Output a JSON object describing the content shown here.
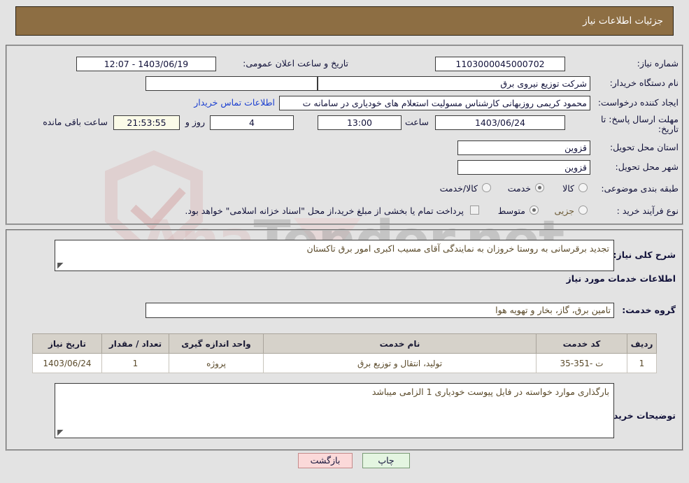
{
  "header": {
    "title": "جزئیات اطلاعات نیاز"
  },
  "form": {
    "need_number": {
      "label": "شماره نیاز:",
      "value": "1103000045000702"
    },
    "public_announce": {
      "label": "تاریخ و ساعت اعلان عمومی:",
      "value": "1403/06/19 - 12:07"
    },
    "buyer_org": {
      "label": "نام دستگاه خریدار:",
      "value": "شرکت توزیع نیروی برق"
    },
    "buyer_org_secondary": {
      "value": ""
    },
    "requester": {
      "label": "ایجاد کننده درخواست:",
      "value": "محمود کریمی روزبهانی کارشناس  مسولیت استعلام های خودیاری در سامانه ت"
    },
    "contact_link": {
      "label": "اطلاعات تماس خریدار"
    },
    "deadline": {
      "label": "مهلت ارسال پاسخ: تا تاریخ:",
      "date": "1403/06/24",
      "hour_label": "ساعت",
      "time": "13:00",
      "days": "4",
      "days_unit_label": "روز و",
      "countdown": "21:53:55",
      "countdown_label": "ساعت باقی مانده"
    },
    "delivery_province": {
      "label": "استان محل تحویل:",
      "value": "قزوین"
    },
    "delivery_city": {
      "label": "شهر محل تحویل:",
      "value": "قزوین"
    },
    "category": {
      "label": "طبقه بندی موضوعی:",
      "options": [
        {
          "label": "کالا",
          "selected": false
        },
        {
          "label": "خدمت",
          "selected": true
        },
        {
          "label": "کالا/خدمت",
          "selected": false
        }
      ]
    },
    "purchase_type": {
      "label": "نوع فرآیند خرید :",
      "options": [
        {
          "label": "جزیی",
          "selected": false
        },
        {
          "label": "متوسط",
          "selected": true
        }
      ],
      "treasury_checkbox": {
        "checked": false,
        "label": "پرداخت تمام یا بخشی از مبلغ خرید،از محل \"اسناد خزانه اسلامی\" خواهد بود."
      }
    }
  },
  "need_summary": {
    "label": "شرح کلی نیاز:",
    "value": "تجدید برقرسانی به روستا خروزان به نمایندگی آقای مسیب اکبری امور برق تاکستان"
  },
  "services_section": {
    "heading": "اطلاعات خدمات مورد نیاز",
    "group_label": "گروه خدمت:",
    "group_value": "تامین برق، گاز، بخار و تهویه هوا",
    "table": {
      "columns": [
        "ردیف",
        "کد خدمت",
        "نام خدمت",
        "واحد اندازه گیری",
        "تعداد / مقدار",
        "تاریخ نیاز"
      ],
      "rows": [
        [
          "1",
          "ت -351-35",
          "تولید، انتقال و توزیع برق",
          "پروژه",
          "1",
          "1403/06/24"
        ]
      ]
    }
  },
  "buyer_notes": {
    "label": "توضیحات خریدار:",
    "value": "بارگذاری موارد خواسته در فایل پیوست خودیاری 1 الزامی میباشد"
  },
  "buttons": {
    "print": "چاپ",
    "back": "بازگشت"
  },
  "watermark": {
    "text_left": "Ana",
    "text_right": "Tender.net"
  }
}
